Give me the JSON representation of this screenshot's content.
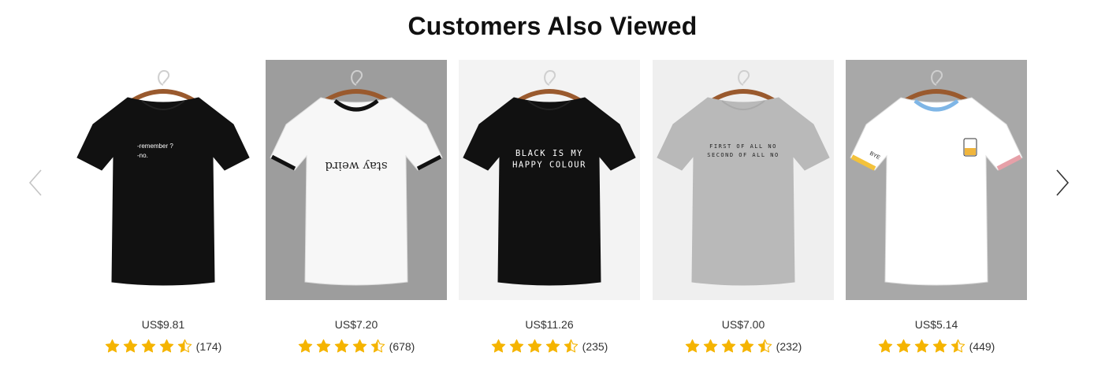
{
  "section": {
    "title": "Customers Also Viewed"
  },
  "colors": {
    "star": "#f5b400",
    "star_empty": "#e0e0e0"
  },
  "nav": {
    "prev_icon": "chevron-left-icon",
    "next_icon": "chevron-right-icon"
  },
  "products": [
    {
      "price": "US$9.81",
      "rating": 4.5,
      "count": "(174)",
      "shirt_color": "#111111",
      "background": "#ffffff",
      "print_text": [
        "-remember ?",
        "-no."
      ],
      "trim": "none"
    },
    {
      "price": "US$7.20",
      "rating": 4.5,
      "count": "(678)",
      "shirt_color": "#f7f7f7",
      "background": "#9d9d9d",
      "print_text": [
        "stay weird"
      ],
      "trim": "black"
    },
    {
      "price": "US$11.26",
      "rating": 4.5,
      "count": "(235)",
      "shirt_color": "#111111",
      "background": "#f3f3f3",
      "print_text": [
        "BLACK IS MY",
        "HAPPY COLOUR"
      ],
      "trim": "none"
    },
    {
      "price": "US$7.00",
      "rating": 4.5,
      "count": "(232)",
      "shirt_color": "#b9b9b9",
      "background": "#efefef",
      "print_text": [
        "FIRST OF ALL NO",
        "SECOND OF ALL NO"
      ],
      "trim": "none"
    },
    {
      "price": "US$5.14",
      "rating": 4.5,
      "count": "(449)",
      "shirt_color": "#ffffff",
      "background": "#a8a8a8",
      "print_text": [
        "BYE"
      ],
      "trim": "color"
    }
  ]
}
